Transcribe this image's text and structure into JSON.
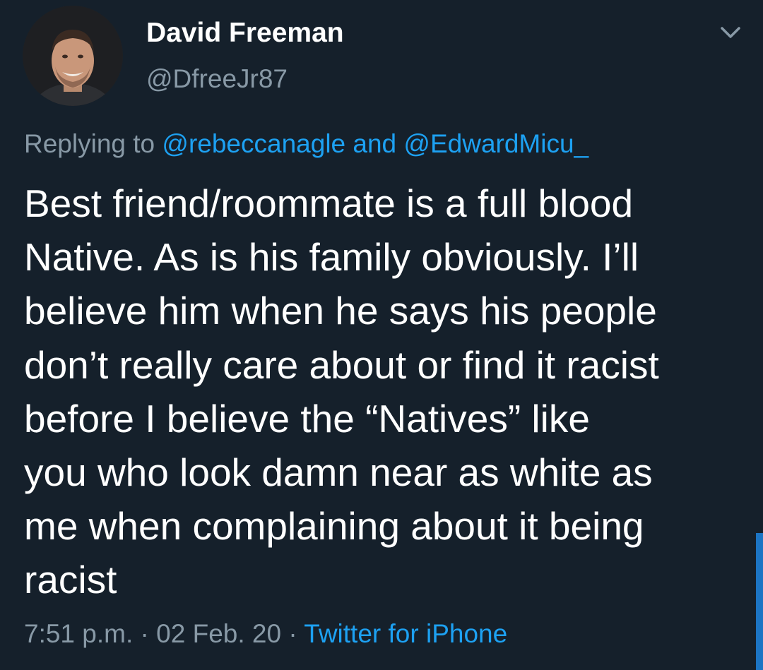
{
  "author": {
    "display_name": "David Freeman",
    "handle": "@DfreeJr87"
  },
  "reply": {
    "prefix": "Replying to ",
    "mention_1": "@rebeccanagle",
    "conjunction": " and ",
    "mention_2": "@EdwardMicu_"
  },
  "tweet": {
    "lines": [
      "Best friend/roommate is a full blood",
      "Native. As is his family obviously. I’ll",
      "believe him when he says his people",
      "don’t really care about or find it racist",
      "before I believe the “Natives” like",
      "you who look damn near as white as",
      "me when complaining about it being",
      "racist"
    ]
  },
  "meta": {
    "time": "7:51 p.m.",
    "separator": " · ",
    "date": "02 Feb. 20",
    "source": "Twitter for iPhone"
  },
  "icons": {
    "menu": "chevron-down-icon"
  },
  "colors": {
    "background": "#15202b",
    "text": "#ffffff",
    "secondary": "#8899a6",
    "link": "#1da1f2"
  }
}
